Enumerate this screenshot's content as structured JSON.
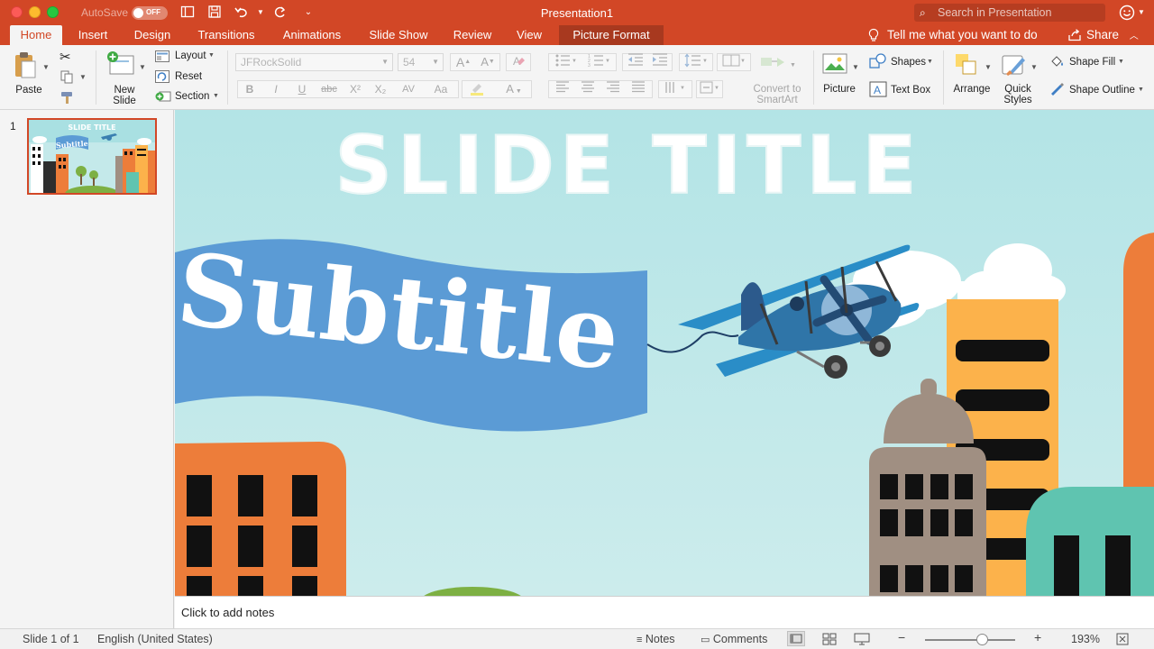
{
  "window": {
    "autosave_label": "AutoSave",
    "autosave_state": "OFF",
    "document_title": "Presentation1",
    "search_placeholder": "Search in Presentation"
  },
  "tabs": [
    {
      "label": "Home",
      "active": true
    },
    {
      "label": "Insert"
    },
    {
      "label": "Design"
    },
    {
      "label": "Transitions"
    },
    {
      "label": "Animations"
    },
    {
      "label": "Slide Show"
    },
    {
      "label": "Review"
    },
    {
      "label": "View"
    },
    {
      "label": "Picture Format",
      "contextual": true
    }
  ],
  "tell_me": "Tell me what you want to do",
  "share": "Share",
  "ribbon": {
    "paste": "Paste",
    "new_slide": "New\nSlide",
    "layout": "Layout",
    "reset": "Reset",
    "section": "Section",
    "font_name": "JFRockSolid",
    "font_size": "54",
    "convert_smartart": "Convert to\nSmartArt",
    "picture": "Picture",
    "shapes": "Shapes",
    "text_box": "Text Box",
    "arrange": "Arrange",
    "quick_styles": "Quick\nStyles",
    "shape_fill": "Shape Fill",
    "shape_outline": "Shape Outline",
    "format_buttons": [
      "B",
      "I",
      "U",
      "abc",
      "X²",
      "X₂",
      "AV",
      "Aa"
    ]
  },
  "thumbnail": {
    "number": "1",
    "title": "SLIDE TITLE",
    "subtitle": "Subtitle"
  },
  "slide": {
    "title": "SLIDE TITLE",
    "subtitle": "Subtitle"
  },
  "notes_placeholder": "Click to add notes",
  "status": {
    "slide_info": "Slide 1 of 1",
    "language": "English (United States)",
    "notes": "Notes",
    "comments": "Comments",
    "zoom": "193%"
  },
  "colors": {
    "accent": "#d24726",
    "sky": "#c5eaea",
    "banner": "#5b9bd5",
    "orange_building": "#ed7d3a",
    "yellow_building": "#fcb24b",
    "gray_building": "#a08f82",
    "teal_building": "#5fc4b0"
  }
}
